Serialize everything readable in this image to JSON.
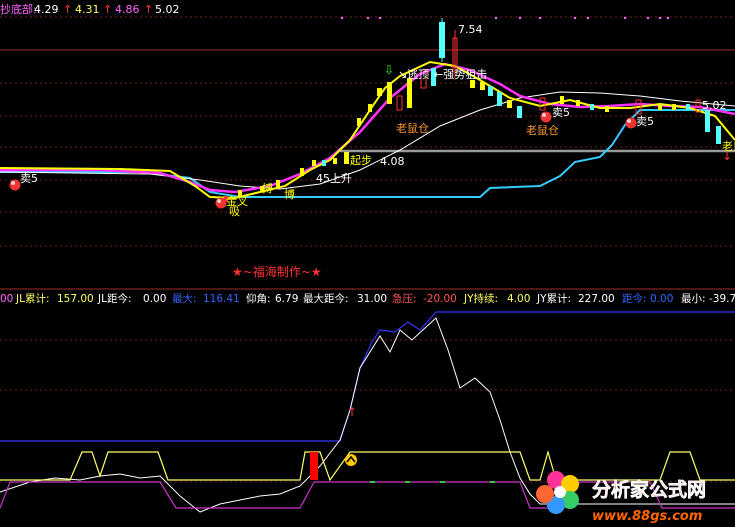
{
  "top_panel": {
    "header": [
      {
        "text": "抄底部:",
        "color": "#ff66ff"
      },
      {
        "text": "4.29",
        "color": "#ffffff"
      },
      {
        "text": "↑",
        "color": "#ff3333"
      },
      {
        "text": "4.31",
        "color": "#ffff66"
      },
      {
        "text": "↑",
        "color": "#ff3333"
      },
      {
        "text": "4.86",
        "color": "#ff66ff"
      },
      {
        "text": "↑",
        "color": "#ff3333"
      },
      {
        "text": "5.02",
        "color": "#ffffff"
      }
    ],
    "price_label_peak": "7.54",
    "price_label_right": "5.02",
    "support_label": "4.08",
    "brand_text": "★~福海制作~★",
    "annotations": [
      {
        "text": "卖5",
        "color": "#ffffff"
      },
      {
        "text": "金叉",
        "color": "#ffff00"
      },
      {
        "text": "搏",
        "color": "#ffff00"
      },
      {
        "text": "博",
        "color": "#ffff00"
      },
      {
        "text": "45上升",
        "color": "#ffffff"
      },
      {
        "text": "起步",
        "color": "#ffff00"
      },
      {
        "text": "老鼠仓",
        "color": "#ff9933"
      },
      {
        "text": "↘逃顶",
        "color": "#ffffff"
      },
      {
        "text": "←强势狙击",
        "color": "#ffffff"
      },
      {
        "text": "老鼠仓",
        "color": "#ff9933"
      },
      {
        "text": "卖5",
        "color": "#ffffff"
      },
      {
        "text": "卖5",
        "color": "#ffffff"
      },
      {
        "text": "老鼠",
        "color": "#ffff00"
      },
      {
        "text": "吸",
        "color": "#ffff00"
      }
    ],
    "colors": {
      "candle_up": "#ff3333",
      "candle_down": "#54ffff",
      "ma_white": "#ffffff",
      "ma_yellow": "#ffff00",
      "ma_magenta": "#ff33ff",
      "support_line": "#9a9a9a",
      "cyan_line": "#33ccff"
    }
  },
  "bottom_panel": {
    "stats": [
      {
        "text": "00",
        "color": "#ff66ff"
      },
      {
        "text": "JL累计:",
        "color": "#ffff66"
      },
      {
        "text": "157.00",
        "color": "#ffff66"
      },
      {
        "text": "JL距今:",
        "color": "#ffffff"
      },
      {
        "text": "0.00",
        "color": "#ffffff"
      },
      {
        "text": "最大:",
        "color": "#3366ff"
      },
      {
        "text": "116.41",
        "color": "#3366ff"
      },
      {
        "text": "仰角:",
        "color": "#ffffff"
      },
      {
        "text": "6.79",
        "color": "#ffffff"
      },
      {
        "text": "最大距今:",
        "color": "#ffffff"
      },
      {
        "text": "31.00",
        "color": "#ffffff"
      },
      {
        "text": "急压:",
        "color": "#ff5555"
      },
      {
        "text": "-20.00",
        "color": "#ff5555"
      },
      {
        "text": "JY持续:",
        "color": "#ffff66"
      },
      {
        "text": "4.00",
        "color": "#ffff66"
      },
      {
        "text": "JY累计:",
        "color": "#ffffff"
      },
      {
        "text": "227.00",
        "color": "#ffffff"
      },
      {
        "text": "距今:",
        "color": "#3366ff"
      },
      {
        "text": "0.00",
        "color": "#3366ff"
      },
      {
        "text": "最小:",
        "color": "#ffffff"
      },
      {
        "text": "-39.7",
        "color": "#ffffff"
      }
    ],
    "colors": {
      "white_line": "#ffffff",
      "blue_line": "#3333ff",
      "yellow_line": "#ffff66",
      "magenta_line": "#cc33cc",
      "red_bar": "#ff0000"
    }
  },
  "watermark": {
    "title": "分析家公式网",
    "url": "www.88gs.com"
  }
}
